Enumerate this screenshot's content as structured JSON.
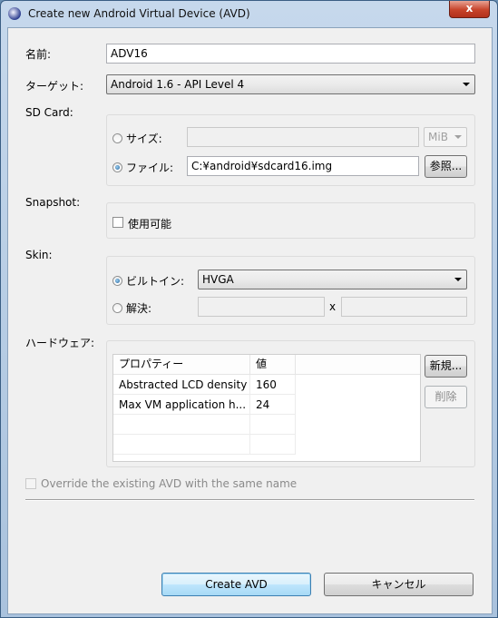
{
  "window": {
    "title": "Create new Android Virtual Device (AVD)",
    "close": "x"
  },
  "name": {
    "label": "名前:",
    "value": "ADV16"
  },
  "target": {
    "label": "ターゲット:",
    "value": "Android 1.6 - API Level 4"
  },
  "sdcard": {
    "label": "SD Card:",
    "size_label": "サイズ:",
    "size_value": "",
    "unit": "MiB",
    "file_label": "ファイル:",
    "file_value": "C:¥android¥sdcard16.img",
    "browse": "参照...",
    "selected": "file"
  },
  "snapshot": {
    "label": "Snapshot:",
    "enabled_label": "使用可能",
    "checked": false
  },
  "skin": {
    "label": "Skin:",
    "builtin_label": "ビルトイン:",
    "builtin_value": "HVGA",
    "resolution_label": "解決:",
    "width": "",
    "x": "x",
    "height": "",
    "selected": "builtin"
  },
  "hardware": {
    "label": "ハードウェア:",
    "columns": [
      "プロパティー",
      "値"
    ],
    "rows": [
      {
        "property": "Abstracted LCD density",
        "value": "160"
      },
      {
        "property": "Max VM application h...",
        "value": "24"
      }
    ],
    "new_button": "新規...",
    "delete_button": "削除"
  },
  "override": {
    "label": "Override the existing AVD with the same name",
    "checked": false
  },
  "buttons": {
    "create": "Create AVD",
    "cancel": "キャンセル"
  }
}
